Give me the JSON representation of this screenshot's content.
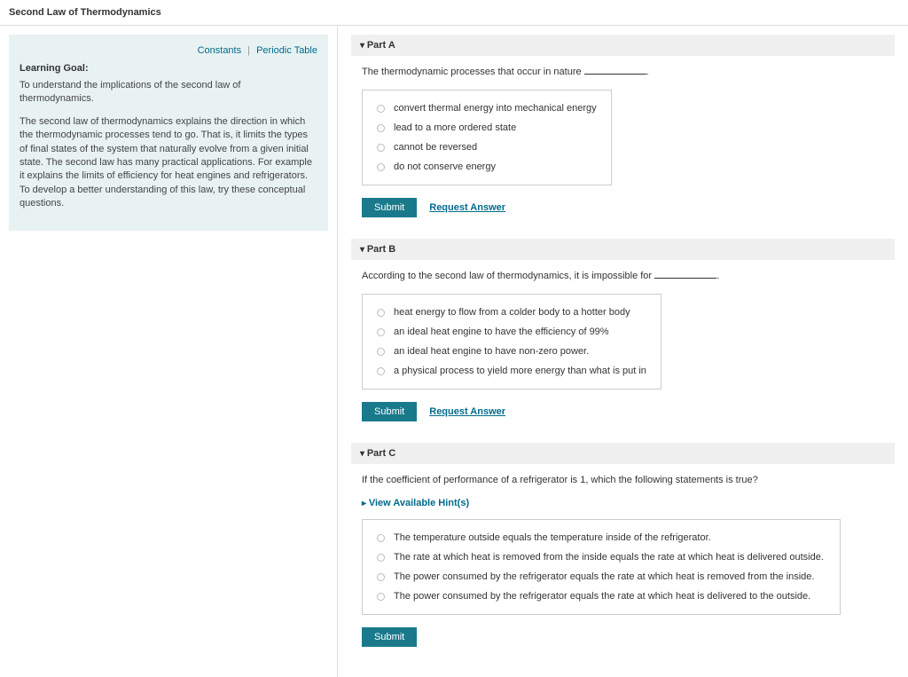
{
  "pageTitle": "Second Law of Thermodynamics",
  "info": {
    "constantsLink": "Constants",
    "periodicLink": "Periodic Table",
    "learningGoalH": "Learning Goal:",
    "goalText": "To understand the implications of the second law of thermodynamics.",
    "description": "The second law of thermodynamics explains the direction in which the thermodynamic processes tend to go. That is, it limits the types of final states of the system that naturally evolve from a given initial state. The second law has many practical applications. For example it explains the limits of efficiency for heat engines and refrigerators. To develop a better understanding of this law, try these conceptual questions."
  },
  "parts": [
    {
      "label": "Part A",
      "questionPre": "The thermodynamic processes that occur in nature ",
      "questionPost": ".",
      "hints": null,
      "options": [
        "convert thermal energy into mechanical energy",
        "lead to a more ordered state",
        "cannot be reversed",
        "do not conserve energy"
      ],
      "submit": "Submit",
      "request": "Request Answer"
    },
    {
      "label": "Part B",
      "questionPre": "According to the second law of thermodynamics, it is impossible for ",
      "questionPost": ".",
      "hints": null,
      "options": [
        "heat energy to flow from a colder body to a hotter body",
        "an ideal heat engine to have the efficiency of 99%",
        "an ideal heat engine to have non-zero power.",
        "a physical process to yield more energy than what is put in"
      ],
      "submit": "Submit",
      "request": "Request Answer"
    },
    {
      "label": "Part C",
      "questionPre": "If the coefficient of performance of a refrigerator is 1, which the following statements is true?",
      "questionPost": "",
      "hints": "View Available Hint(s)",
      "options": [
        "The temperature outside equals the temperature inside of the refrigerator.",
        "The rate at which heat is removed from the inside equals the rate at which heat is delivered outside.",
        "The power consumed by the refrigerator equals the rate at which heat is removed from the inside.",
        "The power consumed by the refrigerator equals the rate at which heat is delivered to the outside."
      ],
      "submit": "Submit",
      "request": null
    }
  ]
}
